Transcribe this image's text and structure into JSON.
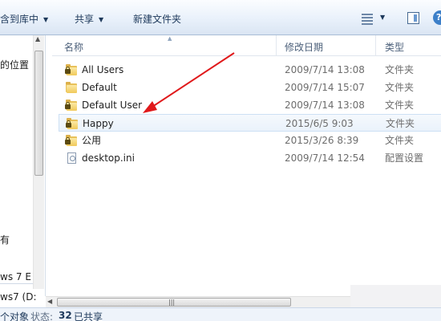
{
  "toolbar": {
    "include_label": "含到库中",
    "share_label": "共享",
    "new_folder_label": "新建文件夹"
  },
  "nav": {
    "location_label": "的位置",
    "has_label": "有",
    "drive1_label": "ws 7 E",
    "drive2_label": "ws7 (D:"
  },
  "columns": {
    "name": "名称",
    "date": "修改日期",
    "type": "类型"
  },
  "files": [
    {
      "name": "All Users",
      "date": "2009/7/14 13:08",
      "type": "文件夹",
      "icon": "folder-lock-icon"
    },
    {
      "name": "Default",
      "date": "2009/7/14 15:07",
      "type": "文件夹",
      "icon": "folder-icon"
    },
    {
      "name": "Default User",
      "date": "2009/7/14 13:08",
      "type": "文件夹",
      "icon": "folder-lock-icon"
    },
    {
      "name": "Happy",
      "date": "2015/6/5 9:03",
      "type": "文件夹",
      "icon": "folder-lock-icon",
      "selected": true
    },
    {
      "name": "公用",
      "date": "2015/3/26 8:39",
      "type": "文件夹",
      "icon": "folder-lock-icon"
    },
    {
      "name": "desktop.ini",
      "date": "2009/7/14 12:54",
      "type": "配置设置",
      "icon": "settings-file-icon"
    }
  ],
  "status": {
    "objects_label": "个对象",
    "state_label": "状态:",
    "count": "32",
    "shared_label": "已共享"
  },
  "colors": {
    "annotation_arrow": "#e0191b",
    "folder": "#f0c95a",
    "toolbar_top": "#fbfdff",
    "toolbar_bottom": "#dae5f3"
  }
}
